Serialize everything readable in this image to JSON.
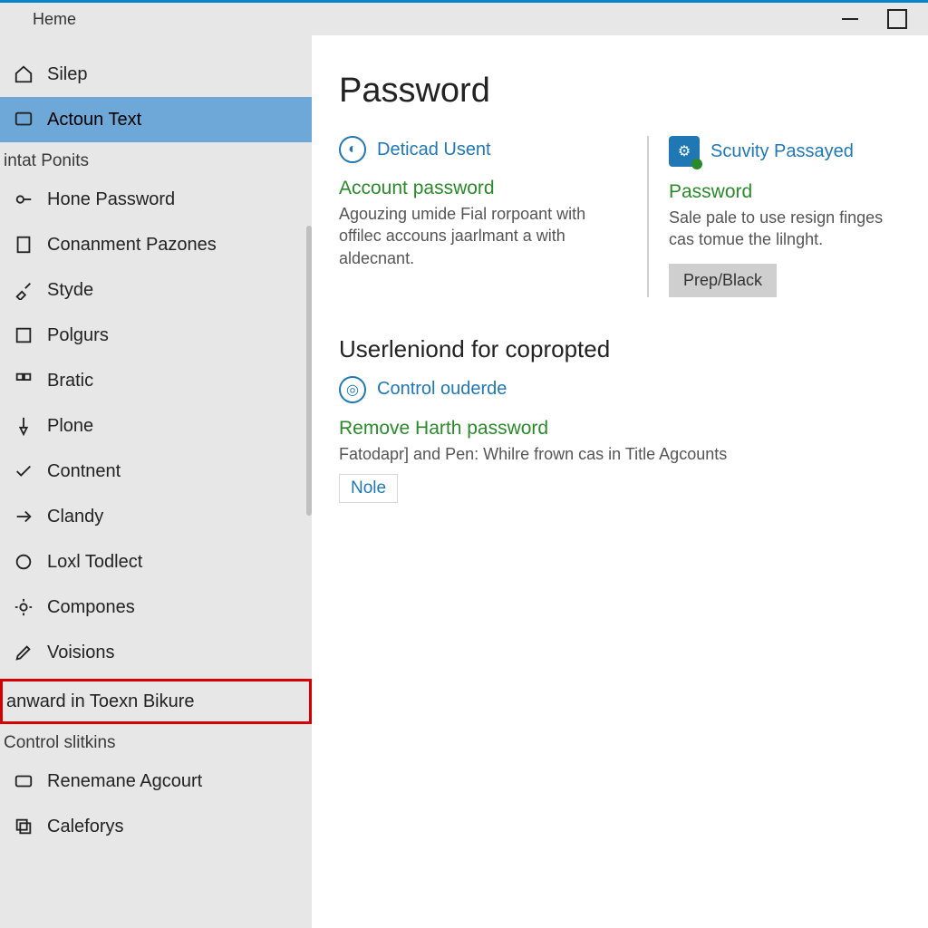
{
  "window": {
    "title": "Heme"
  },
  "sidebar": {
    "items": [
      {
        "label": "Silep"
      },
      {
        "label": "Actoun Text",
        "selected": true
      }
    ],
    "group1_label": "intat Ponits",
    "group1_items": [
      {
        "label": "Hone Password"
      },
      {
        "label": "Conanment Pazones"
      },
      {
        "label": "Styde"
      },
      {
        "label": "Polgurs"
      },
      {
        "label": "Bratic"
      },
      {
        "label": "Plone"
      },
      {
        "label": "Contnent"
      },
      {
        "label": "Clandy"
      },
      {
        "label": "Loxl Todlect"
      },
      {
        "label": "Compones"
      },
      {
        "label": "Voisions"
      }
    ],
    "highlight_label": "anward in Toexn Bikure",
    "group2_label": "Control slitkins",
    "group2_items": [
      {
        "label": "Renemane Agcourt"
      },
      {
        "label": "Caleforys"
      }
    ]
  },
  "main": {
    "title": "Password",
    "link1": "Deticad Usent",
    "col1_heading": "Account password",
    "col1_desc": "Agouzing umide Fial rorpoant with offilec accouns jaarlmant a with aldecnant.",
    "link2": "Scuvity Passayed",
    "col2_heading": "Password",
    "col2_desc": "Sale pale to use resign finges cas tomue the lilnght.",
    "col2_button": "Prep/Black",
    "section2_title": "Userleniond for copropted",
    "link3": "Control ouderde",
    "sec2_heading": "Remove Harth password",
    "sec2_desc": "Fatodapr] and Pen: Whilre frown cas in Title Agcounts",
    "sec2_link": "Nole"
  }
}
